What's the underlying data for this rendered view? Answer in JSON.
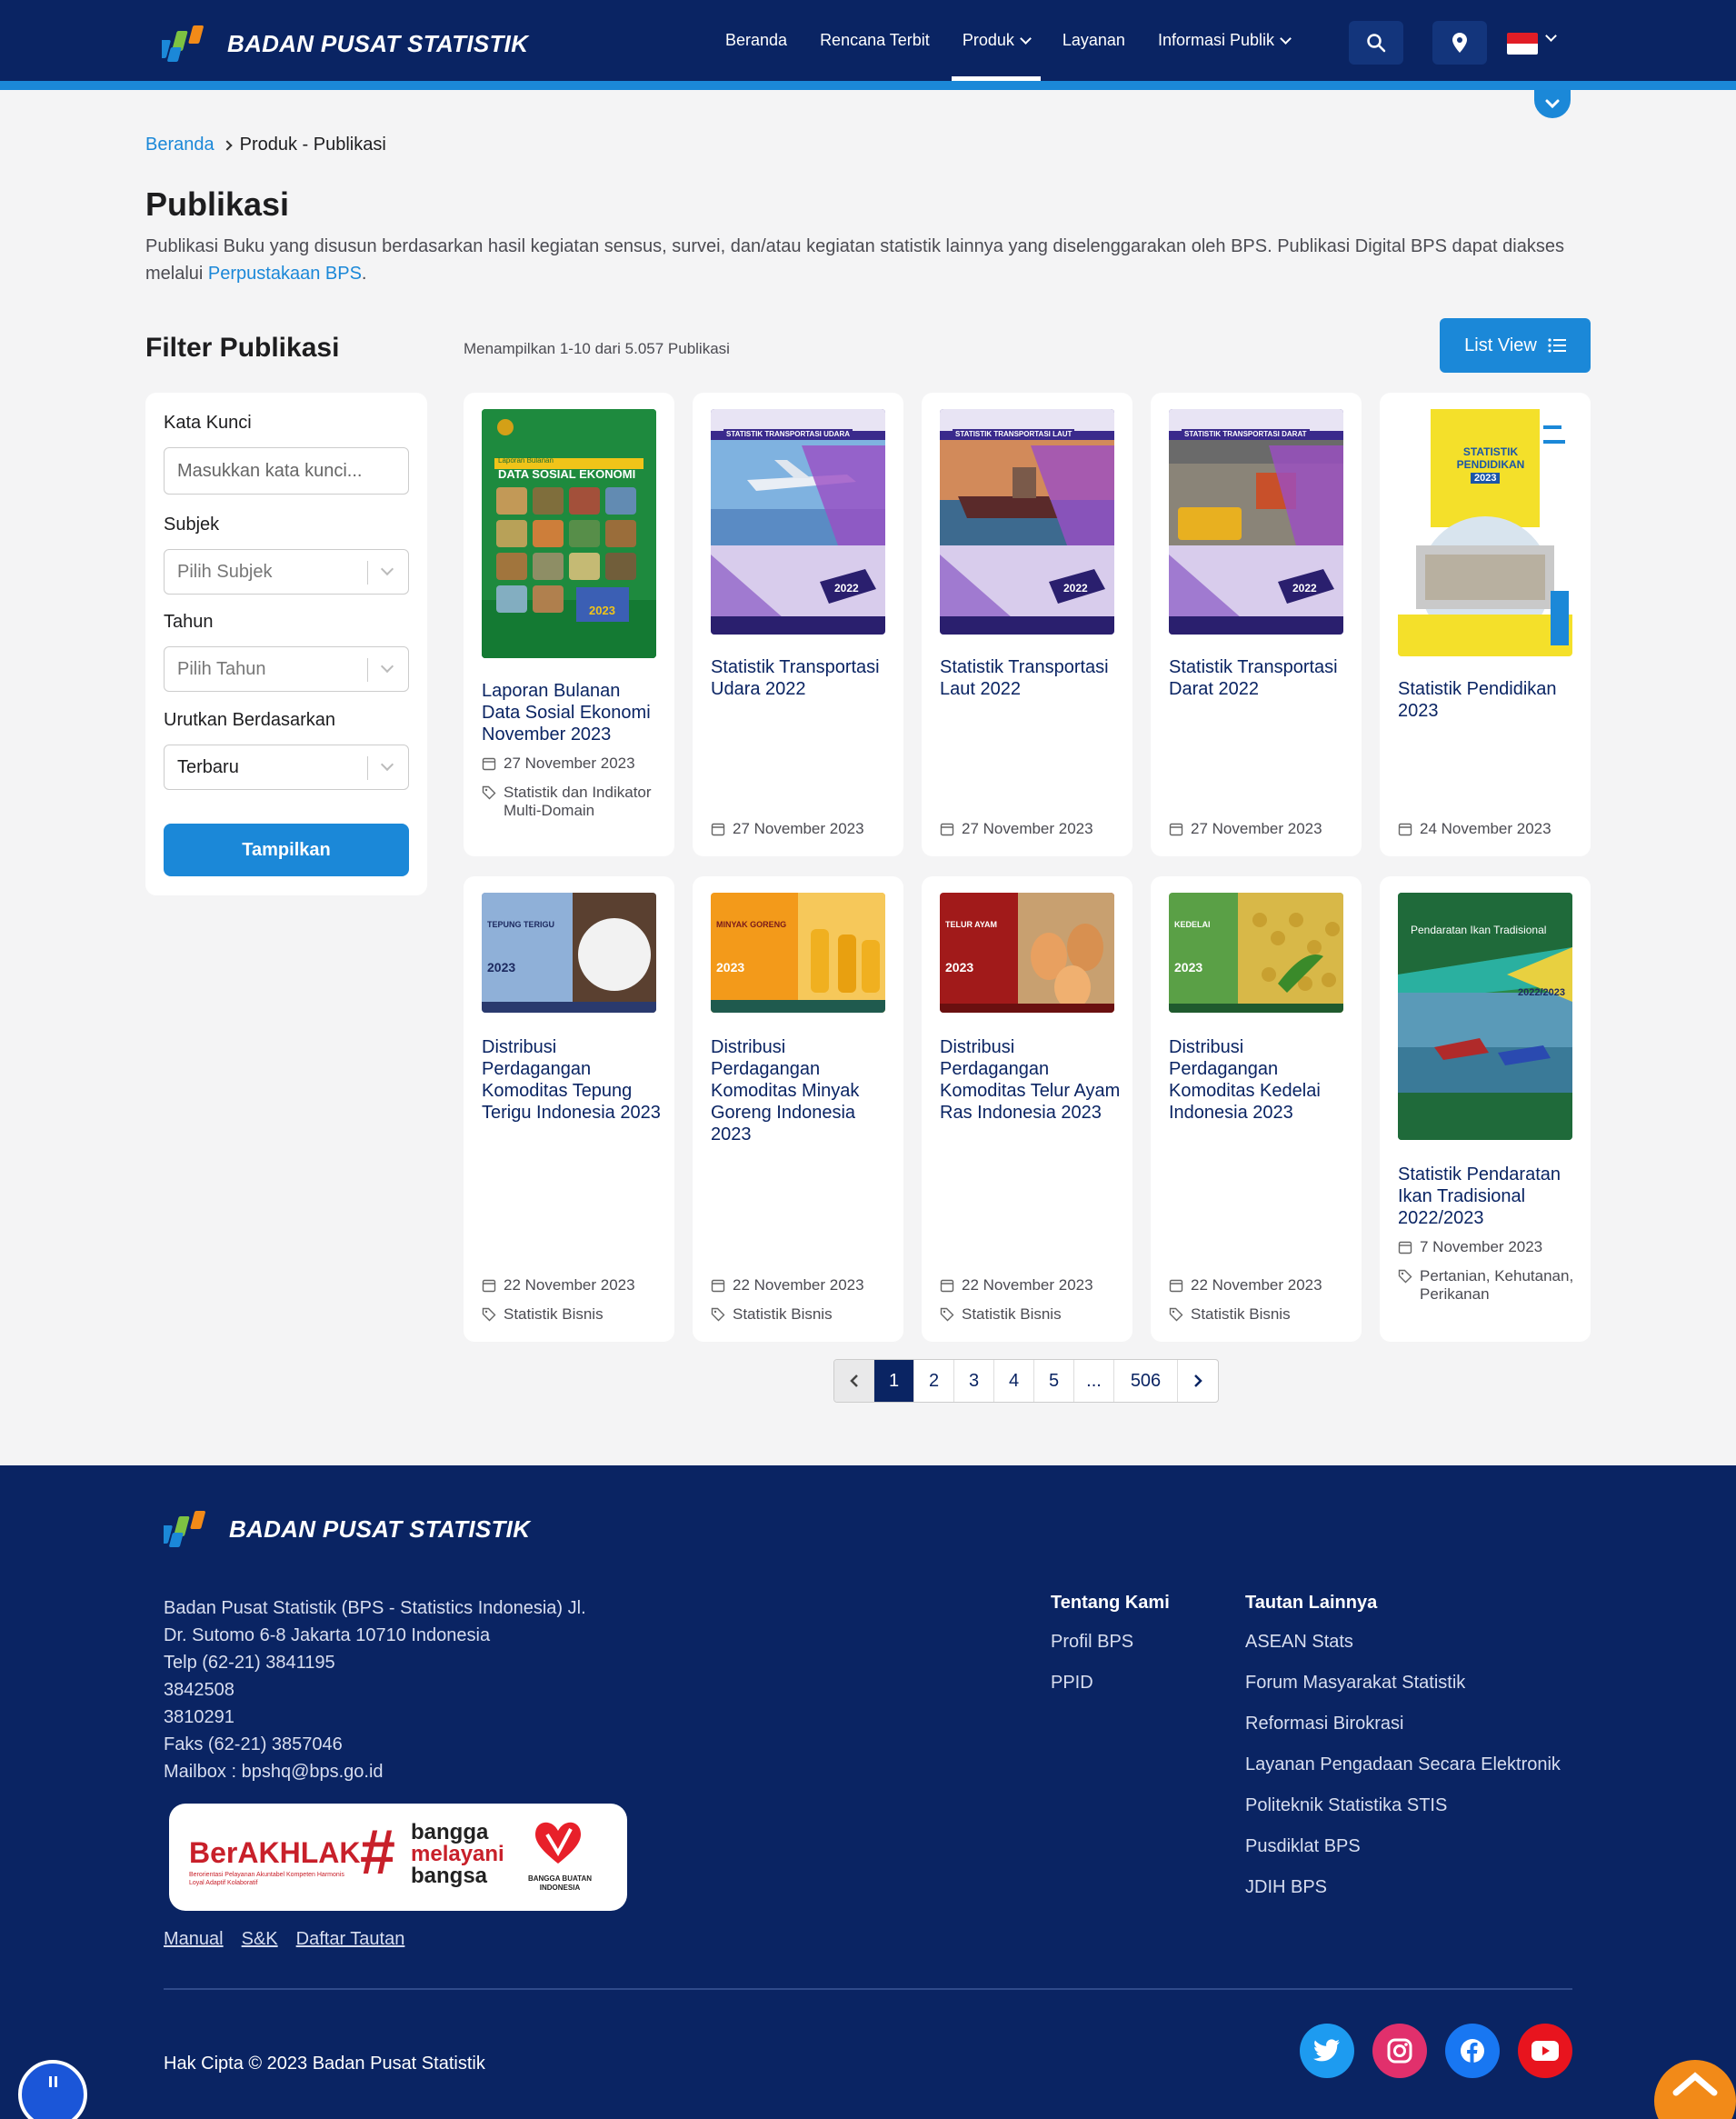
{
  "header": {
    "brand": "BADAN PUSAT STATISTIK",
    "nav": [
      {
        "label": "Beranda"
      },
      {
        "label": "Rencana Terbit"
      },
      {
        "label": "Produk"
      },
      {
        "label": "Layanan"
      },
      {
        "label": "Informasi Publik"
      }
    ],
    "icons": [
      "search-icon",
      "location-icon",
      "flag-indonesia-icon"
    ],
    "colors": {
      "navy": "#0a2463",
      "accent": "#1b88d8"
    }
  },
  "breadcrumb": {
    "home": "Beranda",
    "current": "Produk - Publikasi"
  },
  "page": {
    "title": "Publikasi",
    "desc": "Publikasi Buku yang disusun berdasarkan hasil kegiatan sensus, survei, dan/atau kegiatan statistik lainnya yang diselenggarakan oleh BPS. Publikasi Digital BPS dapat diakses melalui",
    "desc_link": "Perpustakaan BPS",
    "desc_end": "."
  },
  "filter": {
    "title": "Filter Publikasi",
    "keyword_label": "Kata Kunci",
    "keyword_placeholder": "Masukkan kata kunci...",
    "subject_label": "Subjek",
    "subject_value": "Pilih Subjek",
    "year_label": "Tahun",
    "year_value": "Pilih Tahun",
    "sort_label": "Urutkan Berdasarkan",
    "sort_value": "Terbaru",
    "submit": "Tampilkan"
  },
  "results": {
    "count_text": "Menampilkan 1-10 dari 5.057 Publikasi",
    "list_view": "List View"
  },
  "cards": [
    {
      "title": "Laporan Bulanan Data Sosial Ekonomi November 2023",
      "date": "27 November 2023",
      "tag": "Statistik dan Indikator Multi-Domain",
      "cover_title": "DATA SOSIAL EKONOMI",
      "cover_sub": "Laporan Bulanan",
      "cover_year": "2023"
    },
    {
      "title": "Statistik Transportasi Udara 2022",
      "date": "27 November 2023",
      "tag": "",
      "cover_title": "STATISTIK TRANSPORTASI UDARA",
      "cover_year": "2022"
    },
    {
      "title": "Statistik Transportasi Laut 2022",
      "date": "27 November 2023",
      "tag": "",
      "cover_title": "STATISTIK TRANSPORTASI LAUT",
      "cover_year": "2022"
    },
    {
      "title": "Statistik Transportasi Darat 2022",
      "date": "27 November 2023",
      "tag": "",
      "cover_title": "STATISTIK TRANSPORTASI DARAT",
      "cover_year": "2022"
    },
    {
      "title": "Statistik Pendidikan 2023",
      "date": "24 November 2023",
      "tag": "",
      "cover_title": "STATISTIK PENDIDIKAN",
      "cover_year": "2023"
    },
    {
      "title": "Distribusi Perdagangan Komoditas Tepung Terigu Indonesia 2023",
      "date": "22 November 2023",
      "tag": "Statistik Bisnis",
      "cover_title": "TEPUNG TERIGU",
      "cover_year": "2023"
    },
    {
      "title": "Distribusi Perdagangan Komoditas Minyak Goreng Indonesia 2023",
      "date": "22 November 2023",
      "tag": "Statistik Bisnis",
      "cover_title": "MINYAK GORENG",
      "cover_year": "2023"
    },
    {
      "title": "Distribusi Perdagangan Komoditas Telur Ayam Ras Indonesia 2023",
      "date": "22 November 2023",
      "tag": "Statistik Bisnis",
      "cover_title": "TELUR AYAM",
      "cover_year": "2023"
    },
    {
      "title": "Distribusi Perdagangan Komoditas Kedelai Indonesia 2023",
      "date": "22 November 2023",
      "tag": "Statistik Bisnis",
      "cover_title": "KEDELAI",
      "cover_year": "2023"
    },
    {
      "title": "Statistik Pendaratan Ikan Tradisional 2022/2023",
      "date": "7 November 2023",
      "tag": "Pertanian, Kehutanan, Perikanan",
      "cover_title": "Pendaratan Ikan Tradisional",
      "cover_year": "2022/2023"
    }
  ],
  "pagination": {
    "pages": [
      "1",
      "2",
      "3",
      "4",
      "5",
      "...",
      "506"
    ],
    "current": "1"
  },
  "footer": {
    "brand": "BADAN PUSAT STATISTIK",
    "address": [
      "Badan Pusat Statistik (BPS - Statistics Indonesia) Jl.",
      "Dr. Sutomo 6-8 Jakarta 10710 Indonesia",
      "Telp (62-21) 3841195",
      "3842508",
      "3810291",
      "Faks (62-21) 3857046",
      "Mailbox : bpshq@bps.go.id"
    ],
    "badges": {
      "berakhlak": "BerAKHLAK",
      "berakhlak_sub": "Berorientasi Pelayanan Akuntabel Kompeten Harmonis Loyal Adaptif Kolaboratif",
      "bangga_1": "bangga",
      "bangga_2": "melayani",
      "bangga_3": "bangsa",
      "bbi": "BANGGA BUATAN INDONESIA"
    },
    "links": [
      "Manual",
      "S&K",
      "Daftar Tautan"
    ],
    "about_title": "Tentang Kami",
    "about_items": [
      "Profil BPS",
      "PPID"
    ],
    "other_title": "Tautan Lainnya",
    "other_items": [
      "ASEAN Stats",
      "Forum Masyarakat Statistik",
      "Reformasi Birokrasi",
      "Layanan Pengadaan Secara Elektronik",
      "Politeknik Statistika STIS",
      "Pusdiklat BPS",
      "JDIH BPS"
    ],
    "copyright": "Hak Cipta © 2023 Badan Pusat Statistik",
    "social": [
      "twitter-icon",
      "instagram-icon",
      "facebook-icon",
      "youtube-icon"
    ]
  }
}
